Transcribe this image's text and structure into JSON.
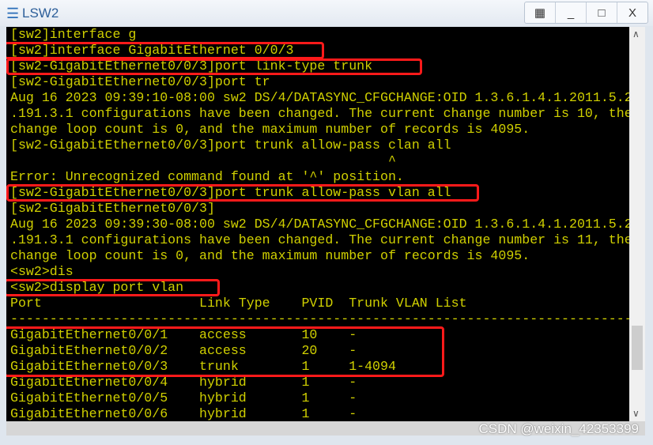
{
  "window": {
    "title": "LSW2",
    "buttons": [
      "restore-layout",
      "minimize",
      "maximize",
      "close"
    ],
    "close_label": "X"
  },
  "terminal": {
    "text_color": "#d0d000",
    "lines": [
      "[sw2]interface g",
      "[sw2]interface GigabitEthernet 0/0/3",
      "[sw2-GigabitEthernet0/0/3]port link-type trunk",
      "[sw2-GigabitEthernet0/0/3]port tr",
      "Aug 16 2023 09:39:10-08:00 sw2 DS/4/DATASYNC_CFGCHANGE:OID 1.3.6.1.4.1.2011.5.2",
      ".191.3.1 configurations have been changed. The current change number is 10, the",
      "change loop count is 0, and the maximum number of records is 4095.",
      "[sw2-GigabitEthernet0/0/3]port trunk allow-pass clan all",
      "                                                ^",
      "Error: Unrecognized command found at '^' position.",
      "[sw2-GigabitEthernet0/0/3]port trunk allow-pass vlan all",
      "[sw2-GigabitEthernet0/0/3]",
      "Aug 16 2023 09:39:30-08:00 sw2 DS/4/DATASYNC_CFGCHANGE:OID 1.3.6.1.4.1.2011.5.2",
      ".191.3.1 configurations have been changed. The current change number is 11, the",
      "change loop count is 0, and the maximum number of records is 4095.",
      "<sw2>dis",
      "<sw2>display port vlan",
      "Port                    Link Type    PVID  Trunk VLAN List",
      "-------------------------------------------------------------------------------",
      "GigabitEthernet0/0/1    access       10    -",
      "GigabitEthernet0/0/2    access       20    -",
      "GigabitEthernet0/0/3    trunk        1     1-4094",
      "GigabitEthernet0/0/4    hybrid       1     -",
      "GigabitEthernet0/0/5    hybrid       1     -",
      "GigabitEthernet0/0/6    hybrid       1     -"
    ],
    "highlight_color": "#ff1a1a"
  },
  "watermark": "CSDN @weixin_42353399"
}
